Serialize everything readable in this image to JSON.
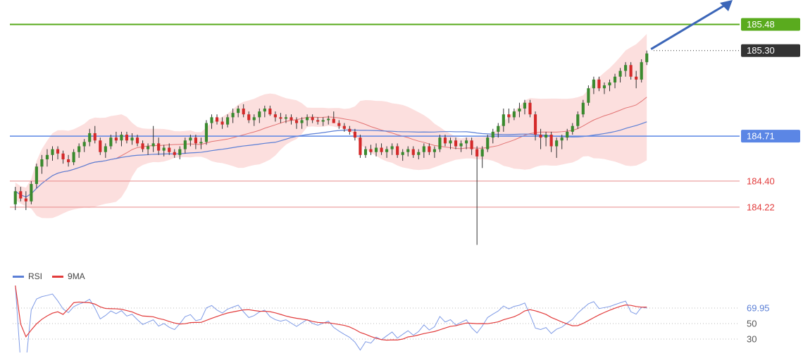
{
  "colors": {
    "candle_up": "#3a8a2e",
    "candle_down": "#d42a2a",
    "band_fill": "#fbd2d0",
    "ma_fast": "#e27373",
    "ma_slow": "#5b7fd6",
    "resistance": "#5aab1e",
    "support_main": "#5b86e5",
    "support_minor": "#e88a8a",
    "arrow": "#3c66b8",
    "rsi": "#7f9be6",
    "rsi_ma": "#e23b3b"
  },
  "price_labels": {
    "resistance": "185.48",
    "current": "185.30",
    "pivot": "184.71",
    "support1": "184.40",
    "support2": "184.22"
  },
  "legend": {
    "rsi": "RSI",
    "ma": "9MA"
  },
  "rsi_labels": {
    "current": "69.95",
    "level50": "50",
    "level30": "30"
  },
  "chart_data": {
    "type": "candlestick",
    "price_axis": {
      "ylim": [
        183.85,
        185.6
      ]
    },
    "levels": {
      "resistance": 185.48,
      "current": 185.3,
      "pivot": 184.71,
      "support1": 184.4,
      "support2": 184.22
    },
    "ohlc": [
      [
        184.24,
        184.36,
        184.2,
        184.33
      ],
      [
        184.33,
        184.36,
        184.26,
        184.28
      ],
      [
        184.28,
        184.33,
        184.2,
        184.26
      ],
      [
        184.26,
        184.4,
        184.24,
        184.38
      ],
      [
        184.38,
        184.52,
        184.35,
        184.5
      ],
      [
        184.5,
        184.58,
        184.45,
        184.55
      ],
      [
        184.55,
        184.62,
        184.5,
        184.58
      ],
      [
        184.58,
        184.64,
        184.54,
        184.62
      ],
      [
        184.62,
        184.64,
        184.55,
        184.59
      ],
      [
        184.59,
        184.61,
        184.52,
        184.55
      ],
      [
        184.55,
        184.58,
        184.5,
        184.53
      ],
      [
        184.53,
        184.62,
        184.51,
        184.6
      ],
      [
        184.6,
        184.66,
        184.56,
        184.64
      ],
      [
        184.64,
        184.69,
        184.6,
        184.67
      ],
      [
        184.67,
        184.76,
        184.64,
        184.73
      ],
      [
        184.73,
        184.78,
        184.66,
        184.68
      ],
      [
        184.68,
        184.7,
        184.58,
        184.6
      ],
      [
        184.6,
        184.66,
        184.56,
        184.64
      ],
      [
        184.64,
        184.72,
        184.62,
        184.7
      ],
      [
        184.7,
        184.74,
        184.66,
        184.68
      ],
      [
        184.68,
        184.74,
        184.64,
        184.72
      ],
      [
        184.72,
        184.74,
        184.66,
        184.68
      ],
      [
        184.68,
        184.73,
        184.65,
        184.7
      ],
      [
        184.7,
        184.72,
        184.64,
        184.66
      ],
      [
        184.66,
        184.68,
        184.6,
        184.62
      ],
      [
        184.62,
        184.66,
        184.58,
        184.64
      ],
      [
        184.64,
        184.78,
        184.6,
        184.66
      ],
      [
        184.66,
        184.7,
        184.58,
        184.61
      ],
      [
        184.61,
        184.65,
        184.57,
        184.63
      ],
      [
        184.63,
        184.66,
        184.58,
        184.6
      ],
      [
        184.6,
        184.62,
        184.56,
        184.58
      ],
      [
        184.58,
        184.64,
        184.55,
        184.62
      ],
      [
        184.62,
        184.7,
        184.59,
        184.68
      ],
      [
        184.68,
        184.72,
        184.64,
        184.7
      ],
      [
        184.7,
        184.72,
        184.62,
        184.66
      ],
      [
        184.66,
        184.7,
        184.62,
        184.67
      ],
      [
        184.67,
        184.82,
        184.65,
        184.8
      ],
      [
        184.8,
        184.86,
        184.76,
        184.84
      ],
      [
        184.84,
        184.86,
        184.79,
        184.81
      ],
      [
        184.81,
        184.84,
        184.76,
        184.79
      ],
      [
        184.79,
        184.86,
        184.77,
        184.84
      ],
      [
        184.84,
        184.9,
        184.8,
        184.87
      ],
      [
        184.87,
        184.92,
        184.84,
        184.9
      ],
      [
        184.9,
        184.93,
        184.84,
        184.86
      ],
      [
        184.86,
        184.88,
        184.8,
        184.82
      ],
      [
        184.82,
        184.86,
        184.78,
        184.84
      ],
      [
        184.84,
        184.9,
        184.8,
        184.88
      ],
      [
        184.88,
        184.92,
        184.84,
        184.9
      ],
      [
        184.9,
        184.92,
        184.85,
        184.86
      ],
      [
        184.86,
        184.88,
        184.81,
        184.84
      ],
      [
        184.84,
        184.87,
        184.8,
        184.83
      ],
      [
        184.83,
        184.86,
        184.8,
        184.84
      ],
      [
        184.84,
        184.86,
        184.79,
        184.82
      ],
      [
        184.82,
        184.84,
        184.76,
        184.8
      ],
      [
        184.8,
        184.84,
        184.76,
        184.82
      ],
      [
        184.82,
        184.86,
        184.78,
        184.84
      ],
      [
        184.84,
        184.86,
        184.8,
        184.82
      ],
      [
        184.82,
        184.84,
        184.79,
        184.81
      ],
      [
        184.81,
        184.84,
        184.78,
        184.82
      ],
      [
        184.82,
        184.85,
        184.79,
        184.83
      ],
      [
        184.83,
        184.88,
        184.8,
        184.8
      ],
      [
        184.8,
        184.82,
        184.76,
        184.78
      ],
      [
        184.78,
        184.8,
        184.74,
        184.76
      ],
      [
        184.76,
        184.78,
        184.72,
        184.74
      ],
      [
        184.74,
        184.76,
        184.68,
        184.7
      ],
      [
        184.7,
        184.72,
        184.56,
        184.58
      ],
      [
        184.58,
        184.64,
        184.56,
        184.62
      ],
      [
        184.62,
        184.65,
        184.58,
        184.6
      ],
      [
        184.6,
        184.66,
        184.57,
        184.63
      ],
      [
        184.63,
        184.66,
        184.58,
        184.6
      ],
      [
        184.6,
        184.64,
        184.56,
        184.62
      ],
      [
        184.62,
        184.66,
        184.58,
        184.64
      ],
      [
        184.64,
        184.66,
        184.56,
        184.58
      ],
      [
        184.58,
        184.62,
        184.54,
        184.6
      ],
      [
        184.6,
        184.64,
        184.57,
        184.62
      ],
      [
        184.62,
        184.64,
        184.56,
        184.58
      ],
      [
        184.58,
        184.62,
        184.55,
        184.6
      ],
      [
        184.6,
        184.66,
        184.56,
        184.64
      ],
      [
        184.64,
        184.66,
        184.58,
        184.6
      ],
      [
        184.6,
        184.64,
        184.56,
        184.62
      ],
      [
        184.62,
        184.72,
        184.6,
        184.7
      ],
      [
        184.7,
        184.72,
        184.64,
        184.66
      ],
      [
        184.66,
        184.7,
        184.62,
        184.68
      ],
      [
        184.68,
        184.7,
        184.62,
        184.64
      ],
      [
        184.64,
        184.68,
        184.6,
        184.66
      ],
      [
        184.66,
        184.7,
        184.62,
        184.68
      ],
      [
        184.68,
        184.7,
        184.58,
        184.62
      ],
      [
        184.62,
        184.64,
        183.96,
        184.57
      ],
      [
        184.57,
        184.64,
        184.49,
        184.62
      ],
      [
        184.62,
        184.72,
        184.6,
        184.7
      ],
      [
        184.7,
        184.76,
        184.66,
        184.74
      ],
      [
        184.74,
        184.8,
        184.7,
        184.78
      ],
      [
        184.78,
        184.9,
        184.74,
        184.86
      ],
      [
        184.86,
        184.9,
        184.8,
        184.84
      ],
      [
        184.84,
        184.9,
        184.82,
        184.88
      ],
      [
        184.88,
        184.94,
        184.84,
        184.9
      ],
      [
        184.9,
        184.96,
        184.86,
        184.94
      ],
      [
        184.94,
        184.96,
        184.84,
        184.86
      ],
      [
        184.86,
        184.88,
        184.68,
        184.72
      ],
      [
        184.72,
        184.76,
        184.62,
        184.7
      ],
      [
        184.7,
        184.74,
        184.64,
        184.72
      ],
      [
        184.72,
        184.74,
        184.6,
        184.64
      ],
      [
        184.64,
        184.7,
        184.56,
        184.68
      ],
      [
        184.68,
        184.72,
        184.62,
        184.7
      ],
      [
        184.7,
        184.76,
        184.68,
        184.74
      ],
      [
        184.74,
        184.8,
        184.72,
        184.78
      ],
      [
        184.78,
        184.88,
        184.76,
        184.86
      ],
      [
        184.86,
        184.96,
        184.84,
        184.94
      ],
      [
        184.94,
        185.06,
        184.92,
        185.04
      ],
      [
        185.04,
        185.12,
        185.0,
        185.1
      ],
      [
        185.1,
        185.12,
        185.02,
        185.04
      ],
      [
        185.04,
        185.08,
        185.0,
        185.06
      ],
      [
        185.06,
        185.1,
        185.02,
        185.08
      ],
      [
        185.08,
        185.14,
        185.04,
        185.12
      ],
      [
        185.12,
        185.18,
        185.08,
        185.16
      ],
      [
        185.16,
        185.22,
        185.12,
        185.2
      ],
      [
        185.2,
        185.22,
        185.1,
        185.12
      ],
      [
        185.12,
        185.16,
        185.04,
        185.1
      ],
      [
        185.1,
        185.24,
        185.08,
        185.22
      ],
      [
        185.22,
        185.3,
        185.2,
        185.28
      ]
    ],
    "rsi": {
      "current": 69.95,
      "levels": [
        50,
        30
      ],
      "ylim": [
        20,
        90
      ]
    }
  }
}
